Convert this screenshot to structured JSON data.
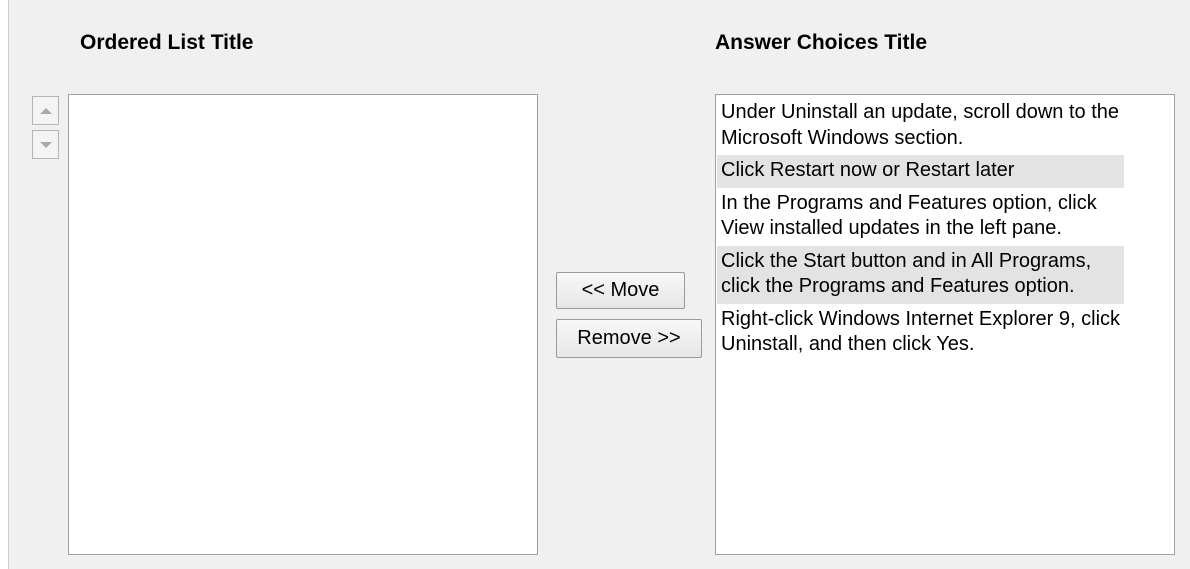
{
  "ordered_list": {
    "title": "Ordered List Title",
    "items": []
  },
  "answer_choices": {
    "title": "Answer Choices Title",
    "items": [
      {
        "text": "Under Uninstall an update, scroll down to the Microsoft Windows section.",
        "shaded": false
      },
      {
        "text": "Click Restart now or Restart later",
        "shaded": true
      },
      {
        "text": "In the Programs and Features option, click View installed updates in the left pane.",
        "shaded": false
      },
      {
        "text": "Click the Start button and in All Programs, click the Programs and Features option.",
        "shaded": true
      },
      {
        "text": "Right-click Windows Internet Explorer 9, click Uninstall, and then click Yes.",
        "shaded": false
      }
    ]
  },
  "controls": {
    "move_label": "<< Move",
    "remove_label": "Remove >>",
    "up_icon": "triangle-up-icon",
    "down_icon": "triangle-down-icon"
  },
  "colors": {
    "panel_background": "#f0f0f0",
    "shaded_item": "#e3e3e3",
    "list_border": "#a0a0a0"
  }
}
